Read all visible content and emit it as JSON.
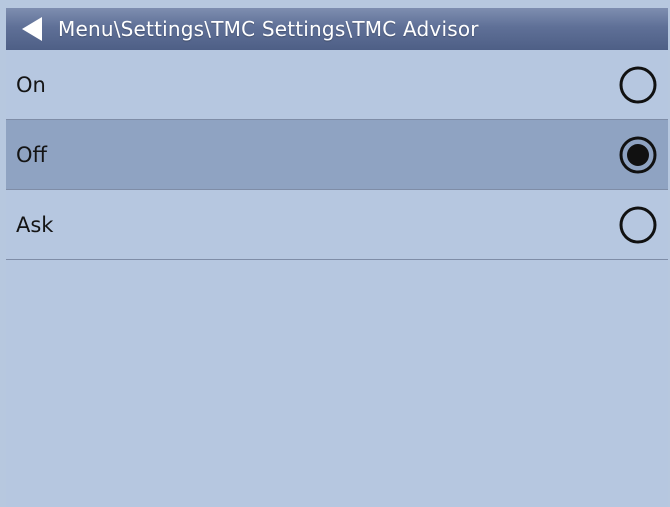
{
  "header": {
    "back_icon": "back-arrow-icon",
    "breadcrumb": "Menu\\Settings\\TMC Settings\\TMC Advisor"
  },
  "options": [
    {
      "label": "On",
      "selected": false
    },
    {
      "label": "Off",
      "selected": true
    },
    {
      "label": "Ask",
      "selected": false
    }
  ],
  "colors": {
    "background": "#b7c8df",
    "titlebar": "#5f7097",
    "selected_row": "#8fa3c2",
    "text": "#141414"
  }
}
